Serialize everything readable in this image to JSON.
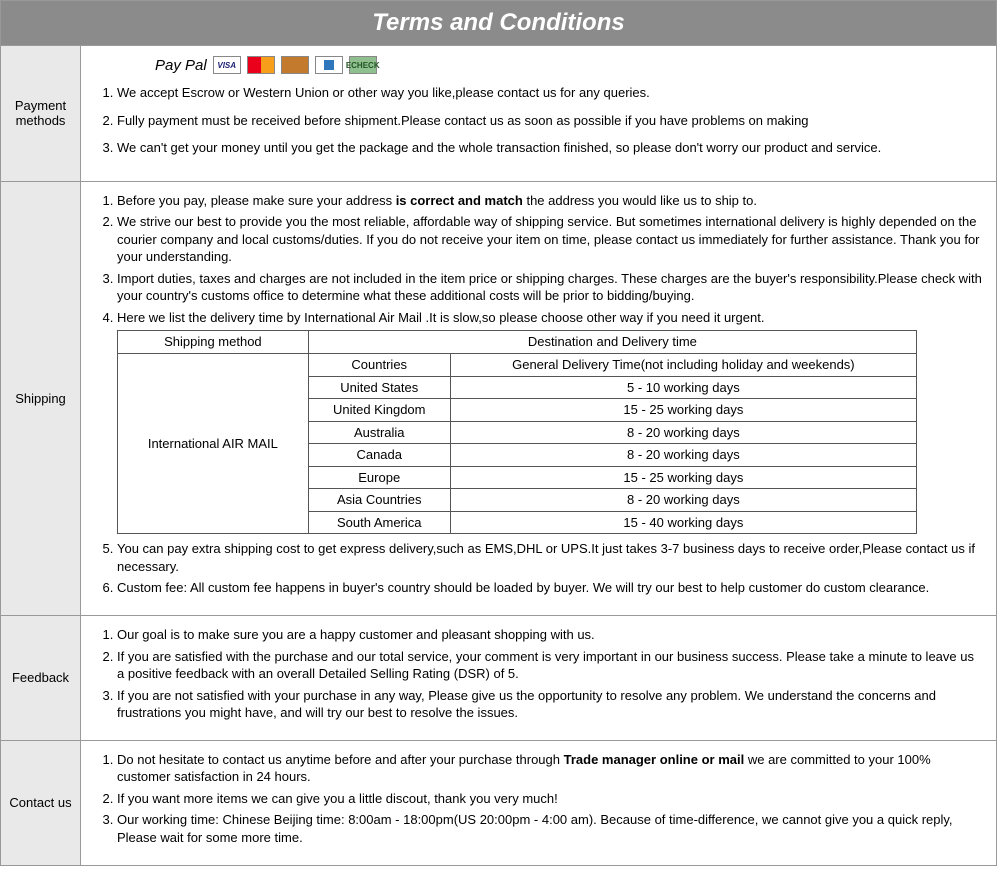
{
  "title": "Terms and Conditions",
  "payment": {
    "label": "Payment methods",
    "paypal": "Pay Pal",
    "items": [
      "We accept Escrow or Western Union or other way you like,please contact us for any queries.",
      "Fully payment must be received before shipment.Please contact us as soon as possible if you have problems on making",
      "We can't get your money until you get the package and the whole transaction finished, so please don't worry our product and service."
    ]
  },
  "shipping": {
    "label": "Shipping",
    "item1_a": "Before you pay, please make sure your address ",
    "item1_b": "is correct and match",
    "item1_c": " the address you would like us to ship to.",
    "item2": "We strive our best to provide you the most reliable, affordable way of shipping service. But sometimes international delivery is highly depended on the courier company and local customs/duties. If you do not receive your item on time, please contact us immediately for further assistance. Thank you for your understanding.",
    "item3": "Import duties, taxes and charges are not included in the item price or shipping charges. These charges are the buyer's responsibility.Please check with your country's customs office to determine what these additional costs will be prior to bidding/buying.",
    "item4": "Here we list the delivery time by International Air Mail .It is slow,so please choose other way if you need it urgent.",
    "table": {
      "h_method": "Shipping method",
      "h_dest": "Destination and Delivery time",
      "h_countries": "Countries",
      "h_general": "General Delivery Time(not including holiday and weekends)",
      "method": "International AIR MAIL",
      "rows": [
        {
          "c": "United States",
          "t": "5 - 10 working days"
        },
        {
          "c": "United Kingdom",
          "t": "15 - 25 working days"
        },
        {
          "c": "Australia",
          "t": "8 - 20 working days"
        },
        {
          "c": "Canada",
          "t": "8 - 20 working days"
        },
        {
          "c": "Europe",
          "t": "15 - 25 working days"
        },
        {
          "c": "Asia Countries",
          "t": "8 - 20 working days"
        },
        {
          "c": "South America",
          "t": "15 - 40 working days"
        }
      ]
    },
    "item5": "You can pay extra shipping cost to get express delivery,such as EMS,DHL or UPS.It just takes 3-7 business days to receive order,Please contact us if necessary.",
    "item6": "Custom fee: All custom fee happens in buyer's country should be loaded by buyer. We will try our best to help customer do custom clearance."
  },
  "feedback": {
    "label": "Feedback",
    "items": [
      "Our goal is to make sure you are a happy customer and pleasant shopping with us.",
      "If you are satisfied with the purchase and our total service, your comment is very important in our business success. Please take a minute to leave us a positive feedback with an overall Detailed Selling Rating (DSR) of 5.",
      "If you are not satisfied with your purchase in any way, Please give us the opportunity to resolve any problem. We understand the concerns and frustrations you might have, and will try our best to resolve the issues."
    ]
  },
  "contact": {
    "label": "Contact us",
    "item1_a": "Do not hesitate to contact us anytime before and after your purchase through ",
    "item1_b": "Trade manager online or mail",
    "item1_c": "  we are committed to your 100% customer satisfaction in 24 hours.",
    "item2": "If you want more items we can give you a little discout, thank you very much!",
    "item3": "Our working time: Chinese Beijing time: 8:00am - 18:00pm(US 20:00pm - 4:00 am). Because of time-difference, we cannot give you a quick reply, Please wait for some more time."
  }
}
